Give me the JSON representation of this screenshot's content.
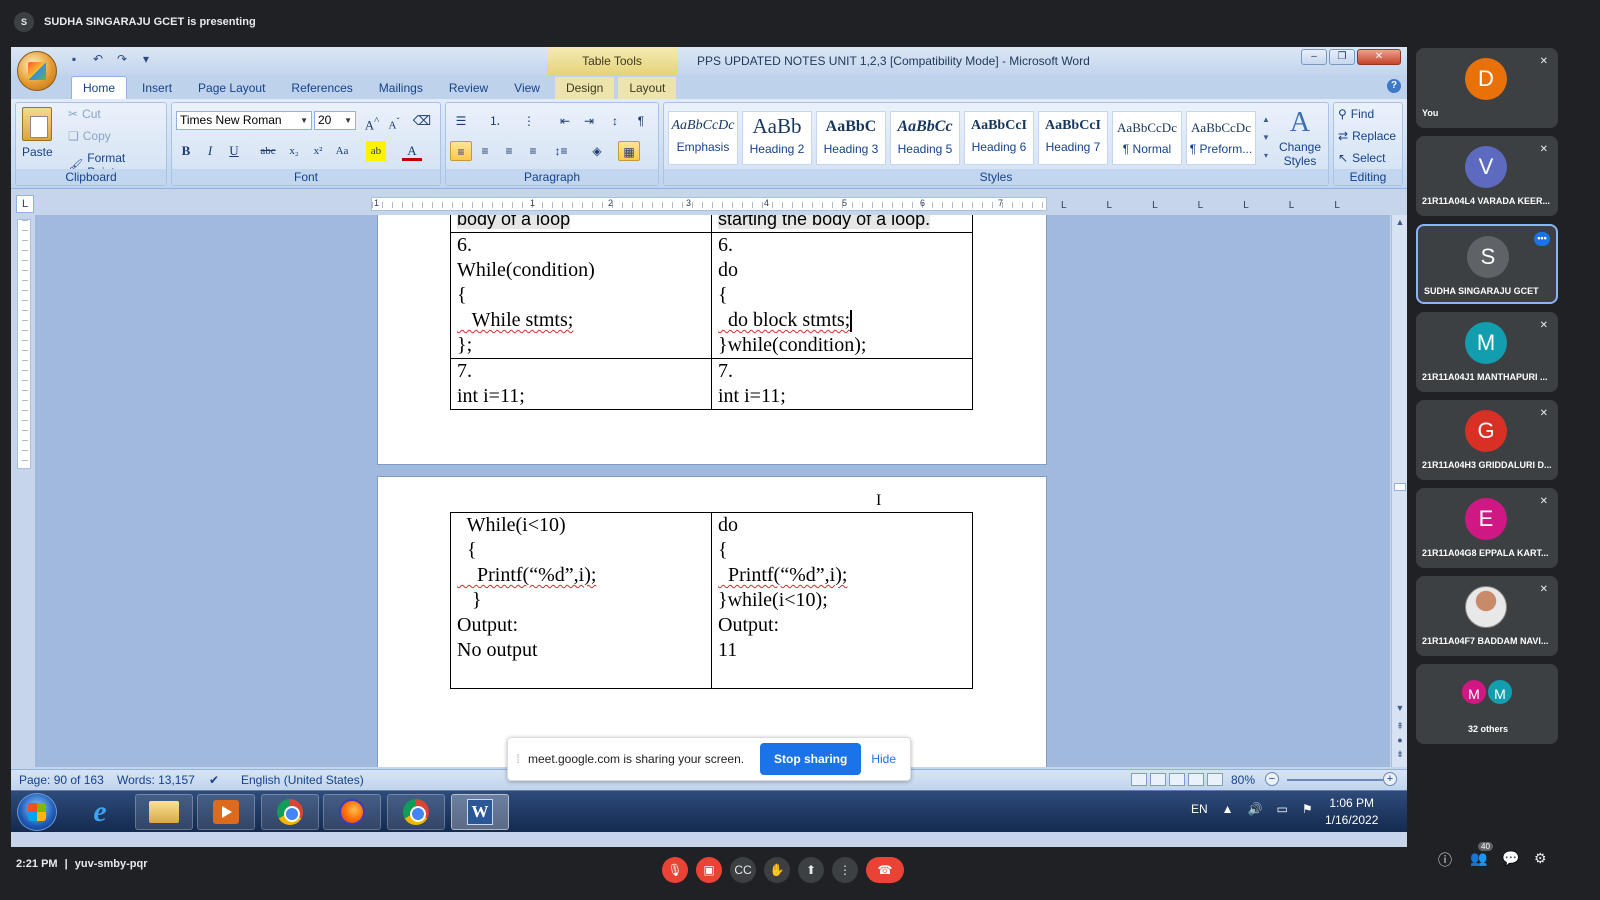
{
  "presenting": {
    "initial": "S",
    "text": "SUDHA SINGARAJU GCET is presenting"
  },
  "word": {
    "table_tools": "Table Tools",
    "title": "PPS UPDATED NOTES UNIT 1,2,3 [Compatibility Mode] - Microsoft Word",
    "tabs": [
      "Home",
      "Insert",
      "Page Layout",
      "References",
      "Mailings",
      "Review",
      "View",
      "Design",
      "Layout"
    ],
    "clipboard": {
      "paste": "Paste",
      "cut": "Cut",
      "copy": "Copy",
      "format_painter": "Format Painter",
      "label": "Clipboard"
    },
    "font": {
      "name": "Times New Roman",
      "size": "20",
      "label": "Font"
    },
    "paragraph": {
      "label": "Paragraph"
    },
    "styles": {
      "label": "Styles",
      "items": [
        {
          "sample": "AaBbCcDc",
          "name": "Emphasis"
        },
        {
          "sample": "AaBb",
          "name": "Heading 2"
        },
        {
          "sample": "AaBbC",
          "name": "Heading 3"
        },
        {
          "sample": "AaBbCc",
          "name": "Heading 5"
        },
        {
          "sample": "AaBbCcI",
          "name": "Heading 6"
        },
        {
          "sample": "AaBbCcI",
          "name": "Heading 7"
        },
        {
          "sample": "AaBbCcDc",
          "name": "¶ Normal"
        },
        {
          "sample": "AaBbCcDc",
          "name": "¶ Preform..."
        }
      ],
      "change_styles": "Change Styles"
    },
    "editing": {
      "find": "Find",
      "replace": "Replace",
      "select": "Select",
      "label": "Editing"
    },
    "ruler_numbers": [
      "1",
      "1",
      "2",
      "3",
      "4",
      "5",
      "6",
      "7"
    ],
    "table1": {
      "row0": {
        "left": "body of a loop",
        "right": "starting the body of a loop."
      },
      "row1": {
        "left": [
          "6.",
          "While(condition)",
          "{",
          "   While stmts;",
          "};"
        ],
        "right": [
          "6.",
          "do",
          "{",
          "  do block stmts;",
          "}while(condition);"
        ]
      },
      "row2": {
        "left": [
          "7.",
          "int i=11;"
        ],
        "right": [
          "7.",
          "int i=11;"
        ]
      }
    },
    "table2": {
      "left": [
        "  While(i<10)",
        "  {",
        "    Printf(“%d”,i);",
        "   }",
        "Output:",
        "No output"
      ],
      "right": [
        "do",
        "{",
        "  Printf(“%d”,i);",
        "}while(i<10);",
        "Output:",
        "11"
      ]
    },
    "status": {
      "page": "Page: 90 of 163",
      "words": "Words: 13,157",
      "language": "English (United States)",
      "zoom": "80%"
    }
  },
  "share_bar": {
    "text": "meet.google.com is sharing your screen.",
    "stop": "Stop sharing",
    "hide": "Hide"
  },
  "taskbar": {
    "lang": "EN",
    "time": "1:06 PM",
    "date": "1/16/2022"
  },
  "participants": [
    {
      "initial": "D",
      "name": "You",
      "color": "#e8710a"
    },
    {
      "initial": "V",
      "name": "21R11A04L4 VARADA KEER...",
      "color": "#5c6bc0"
    },
    {
      "initial": "S",
      "name": "SUDHA SINGARAJU GCET",
      "color": "#3c4043"
    },
    {
      "initial": "M",
      "name": "21R11A04J1 MANTHAPURI ...",
      "color": "#129eaf"
    },
    {
      "initial": "G",
      "name": "21R11A04H3 GRIDDALURI D...",
      "color": "#d93025"
    },
    {
      "initial": "E",
      "name": "21R11A04G8 EPPALA KART...",
      "color": "#d01884"
    },
    {
      "initial": "",
      "name": "21R11A04F7 BADDAM NAVI...",
      "color": "#e8e8e8"
    }
  ],
  "others": {
    "label": "32 others",
    "a": "M",
    "b": "M"
  },
  "meet": {
    "time": "2:21 PM",
    "sep": "|",
    "code": "yuv-smby-pqr",
    "people_count": "40"
  }
}
